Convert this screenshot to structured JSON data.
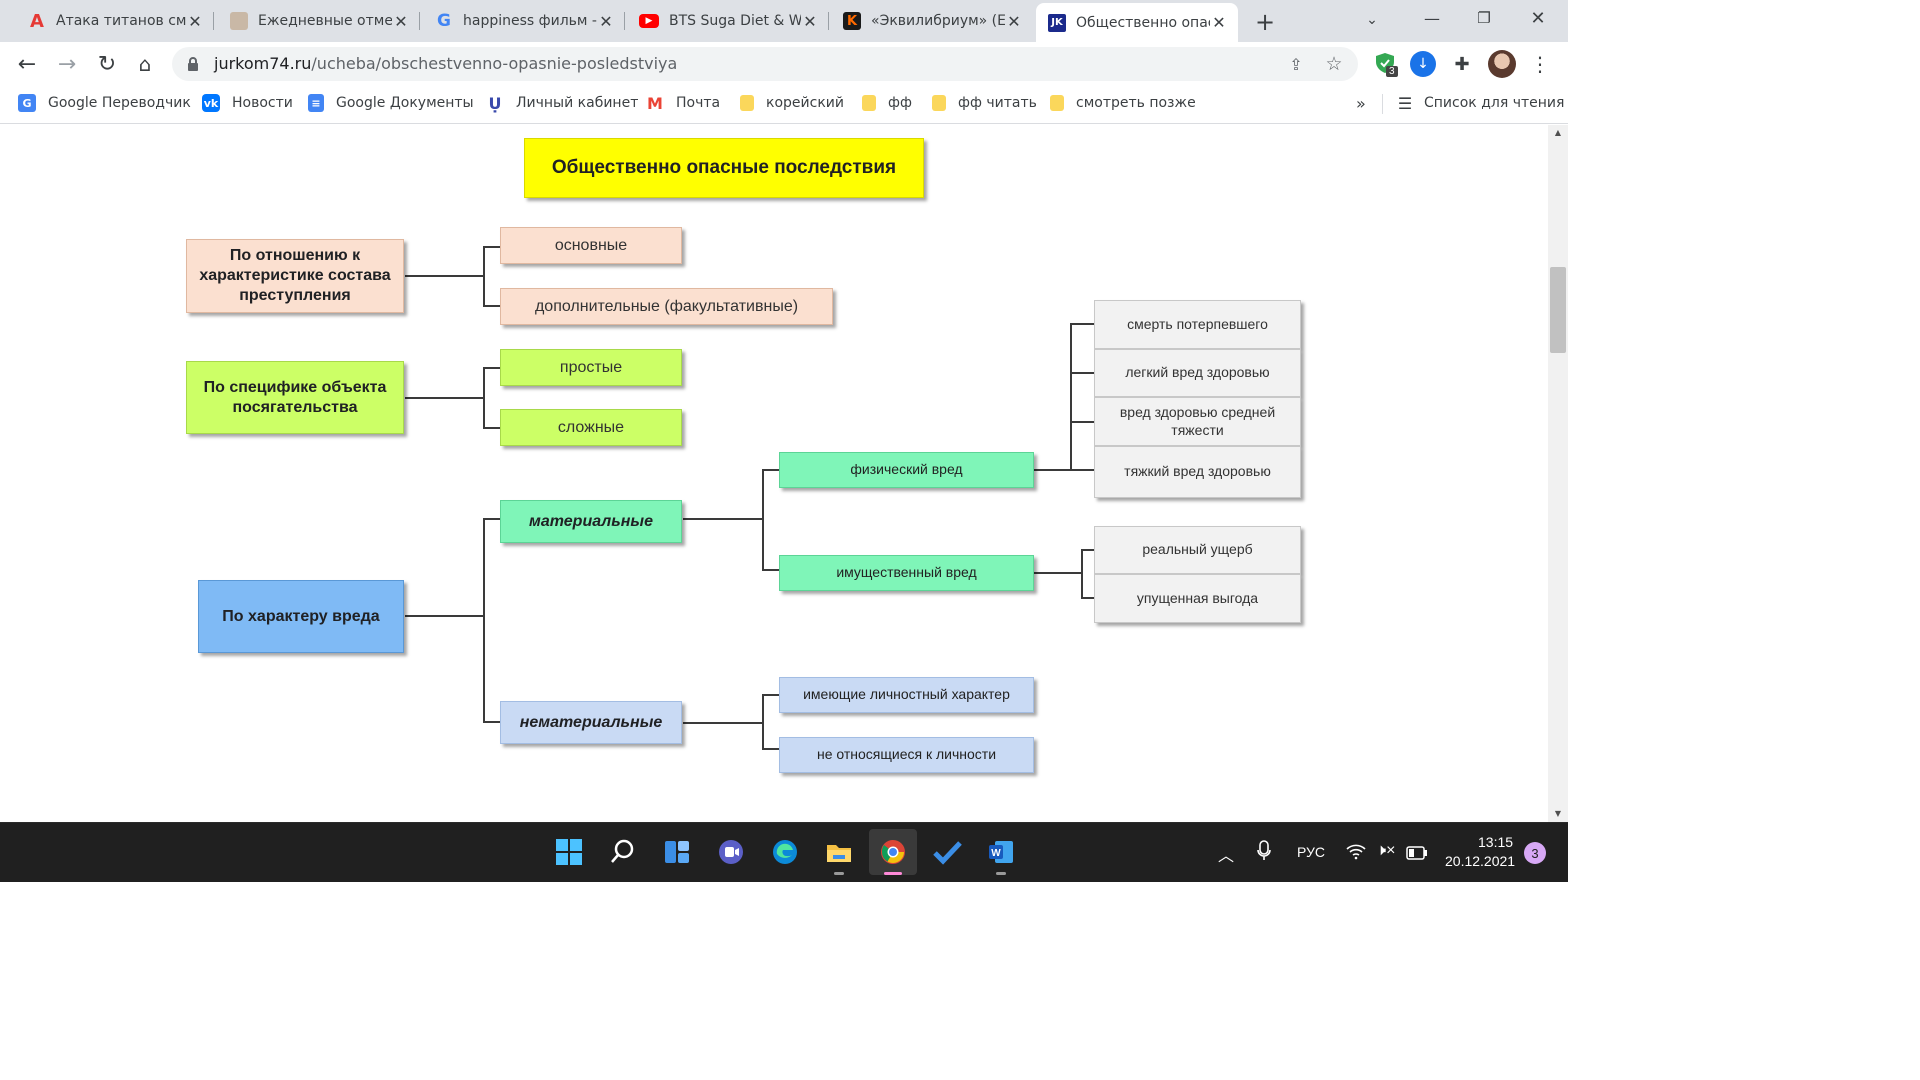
{
  "browser": {
    "tabs": [
      {
        "title": "Атака титанов смо",
        "icon": "anime-a-icon"
      },
      {
        "title": "Ежедневные отмет",
        "icon": "avatar-icon"
      },
      {
        "title": "happiness фильм -",
        "icon": "google-icon"
      },
      {
        "title": "BTS Suga Diet & W",
        "icon": "youtube-icon"
      },
      {
        "title": "«Эквилибриум» (E",
        "icon": "kinopoisk-icon"
      },
      {
        "title": "Общественно опас",
        "icon": "jurkom-icon",
        "active": true
      }
    ],
    "url_host": "jurkom74.ru",
    "url_path": "/ucheba/obschestvenno-opasnie-posledstviya",
    "extension_badge": "3",
    "bookmarks": [
      {
        "label": "Google Переводчик",
        "icon": "google-translate-icon"
      },
      {
        "label": "Новости",
        "icon": "vk-icon"
      },
      {
        "label": "Google Документы",
        "icon": "google-docs-icon"
      },
      {
        "label": "Личный кабинет",
        "icon": "university-icon"
      },
      {
        "label": "Почта",
        "icon": "gmail-icon"
      },
      {
        "label": "корейский",
        "icon": "folder-icon"
      },
      {
        "label": "фф",
        "icon": "folder-icon"
      },
      {
        "label": "фф читать",
        "icon": "folder-icon"
      },
      {
        "label": "смотреть позже",
        "icon": "folder-icon"
      }
    ],
    "overflow": "»",
    "reading_list": "Список для чтения"
  },
  "diagram": {
    "title": "Общественно опасные последствия",
    "groups": [
      {
        "label": "По отношению к характеристике состава преступления",
        "children": [
          "основные",
          "дополнительные (факультативные)"
        ]
      },
      {
        "label": "По специфике объекта посягательства",
        "children": [
          "простые",
          "сложные"
        ]
      },
      {
        "label": "По характеру вреда",
        "children": [
          "материальные",
          "нематериальные"
        ]
      }
    ],
    "material": [
      "физический вред",
      "имущественный вред"
    ],
    "physical": [
      "смерть потерпевшего",
      "легкий вред здоровью",
      "вред здоровью средней тяжести",
      "тяжкий вред здоровью"
    ],
    "property": [
      "реальный ущерб",
      "упущенная выгода"
    ],
    "nonmaterial": [
      "имеющие личностный характер",
      "не относящиеся к личности"
    ],
    "colors": {
      "title": "#ffff00",
      "peach": "#fbe0d0",
      "green": "#ccff66",
      "mint": "#7ff5b8",
      "blue": "#7fbaf5",
      "lightblue": "#c9daf4",
      "gray": "#f2f2f2"
    }
  },
  "taskbar": {
    "apps": [
      "windows-start-icon",
      "search-icon",
      "widgets-icon",
      "teams-icon",
      "edge-icon",
      "file-explorer-icon",
      "chrome-icon",
      "todo-icon",
      "word-icon"
    ],
    "lang": "РУС",
    "time": "13:15",
    "date": "20.12.2021",
    "notifications": "3"
  }
}
